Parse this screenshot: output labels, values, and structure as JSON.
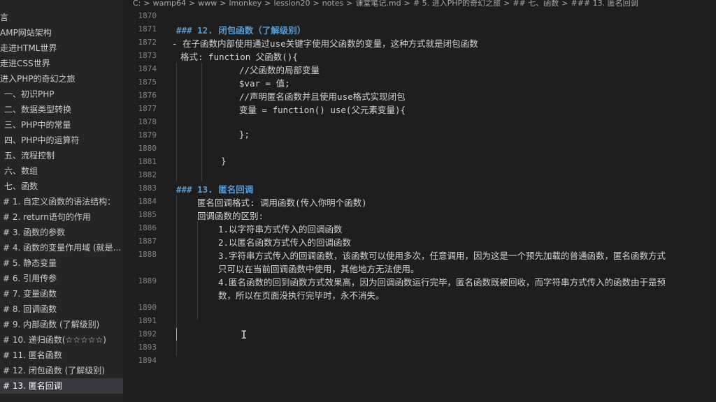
{
  "breadcrumb": [
    "C:",
    ">",
    "wamp64",
    ">",
    "www",
    ">",
    "lmonkey",
    ">",
    "lession20",
    ">",
    "notes",
    ">",
    "课堂笔记.md",
    ">",
    "# 5. 进入PHP的奇幻之旅",
    ">",
    "## 七、函数",
    ">",
    "### 13. 匿名回调"
  ],
  "sidebar": {
    "items": [
      {
        "label": "言"
      },
      {
        "label": "AMP网站架构"
      },
      {
        "label": "走进HTML世界"
      },
      {
        "label": "走进CSS世界"
      },
      {
        "label": "进入PHP的奇幻之旅"
      },
      {
        "label": "一、初识PHP"
      },
      {
        "label": "二、数据类型转换"
      },
      {
        "label": "三、PHP中的常量"
      },
      {
        "label": "四、PHP中的运算符"
      },
      {
        "label": "五、流程控制"
      },
      {
        "label": "六、数组"
      },
      {
        "label": "七、函数"
      },
      {
        "label": "# 1. 自定义函数的语法结构："
      },
      {
        "label": "# 2. return语句的作用"
      },
      {
        "label": "# 3. 函数的参数"
      },
      {
        "label": "# 4. 函数的变量作用域 (就是..."
      },
      {
        "label": "# 5. 静态变量"
      },
      {
        "label": "# 6. 引用传参"
      },
      {
        "label": "# 7. 变量函数"
      },
      {
        "label": "# 8. 回调函数"
      },
      {
        "label": "# 9. 内部函数 (了解级别)"
      },
      {
        "label": "# 10. 递归函数(☆☆☆☆☆)"
      },
      {
        "label": "# 11. 匿名函数"
      },
      {
        "label": "# 12. 闭包函数 (了解级别)"
      },
      {
        "label": "# 13. 匿名回调"
      }
    ]
  },
  "editor": {
    "lines": [
      {
        "num": "1870",
        "text": ""
      },
      {
        "num": "1871",
        "text": "### 12. 闭包函数（了解级别）"
      },
      {
        "num": "1872",
        "text": "- 在子函数内部使用通过use关键字使用父函数的变量，这种方式就是闭包函数"
      },
      {
        "num": "1873",
        "text": "格式:  function 父函数(){"
      },
      {
        "num": "1874",
        "text": "//父函数的局部变量"
      },
      {
        "num": "1875",
        "text": "$var = 值;"
      },
      {
        "num": "1876",
        "text": "//声明匿名函数并且使用use格式实现闭包"
      },
      {
        "num": "1877",
        "text": "变量 = function() use(父元素变量){"
      },
      {
        "num": "1878",
        "text": ""
      },
      {
        "num": "1879",
        "text": "};"
      },
      {
        "num": "1880",
        "text": ""
      },
      {
        "num": "1881",
        "text": "}"
      },
      {
        "num": "1882",
        "text": ""
      },
      {
        "num": "1883",
        "text": "### 13. 匿名回调"
      },
      {
        "num": "1884",
        "text": "匿名回调格式: 调用函数(传入你明个函数)"
      },
      {
        "num": "1885",
        "text": "回调函数的区别:"
      },
      {
        "num": "1886",
        "text": "1.以字符串方式传入的回调函数"
      },
      {
        "num": "1887",
        "text": "2.以匿名函数方式传入的回调函数"
      },
      {
        "num": "1888",
        "text": "3.字符串方式传入的回调函数，该函数可以使用多次，任意调用，因为这是一个预先加载的普通函数，匿名函数方式"
      },
      {
        "num": "",
        "text": "只可以在当前回调函数中使用，其他地方无法使用。"
      },
      {
        "num": "1889",
        "text": "4.匿名函数的回到函数方式效果高，因为回调函数运行完毕，匿名函数既被回收，而字符串方式传入的函数由于是预"
      },
      {
        "num": "",
        "text": "数，所以在页面没执行完毕时，永不消失。"
      },
      {
        "num": "1890",
        "text": ""
      },
      {
        "num": "1891",
        "text": ""
      },
      {
        "num": "1892",
        "text": ""
      },
      {
        "num": "1893",
        "text": ""
      },
      {
        "num": "1894",
        "text": ""
      }
    ]
  },
  "colors": {
    "background": "#1e1e1e",
    "sidebar": "#252526",
    "heading": "#569cd6",
    "text": "#d4d4d4",
    "line_number": "#858585"
  }
}
